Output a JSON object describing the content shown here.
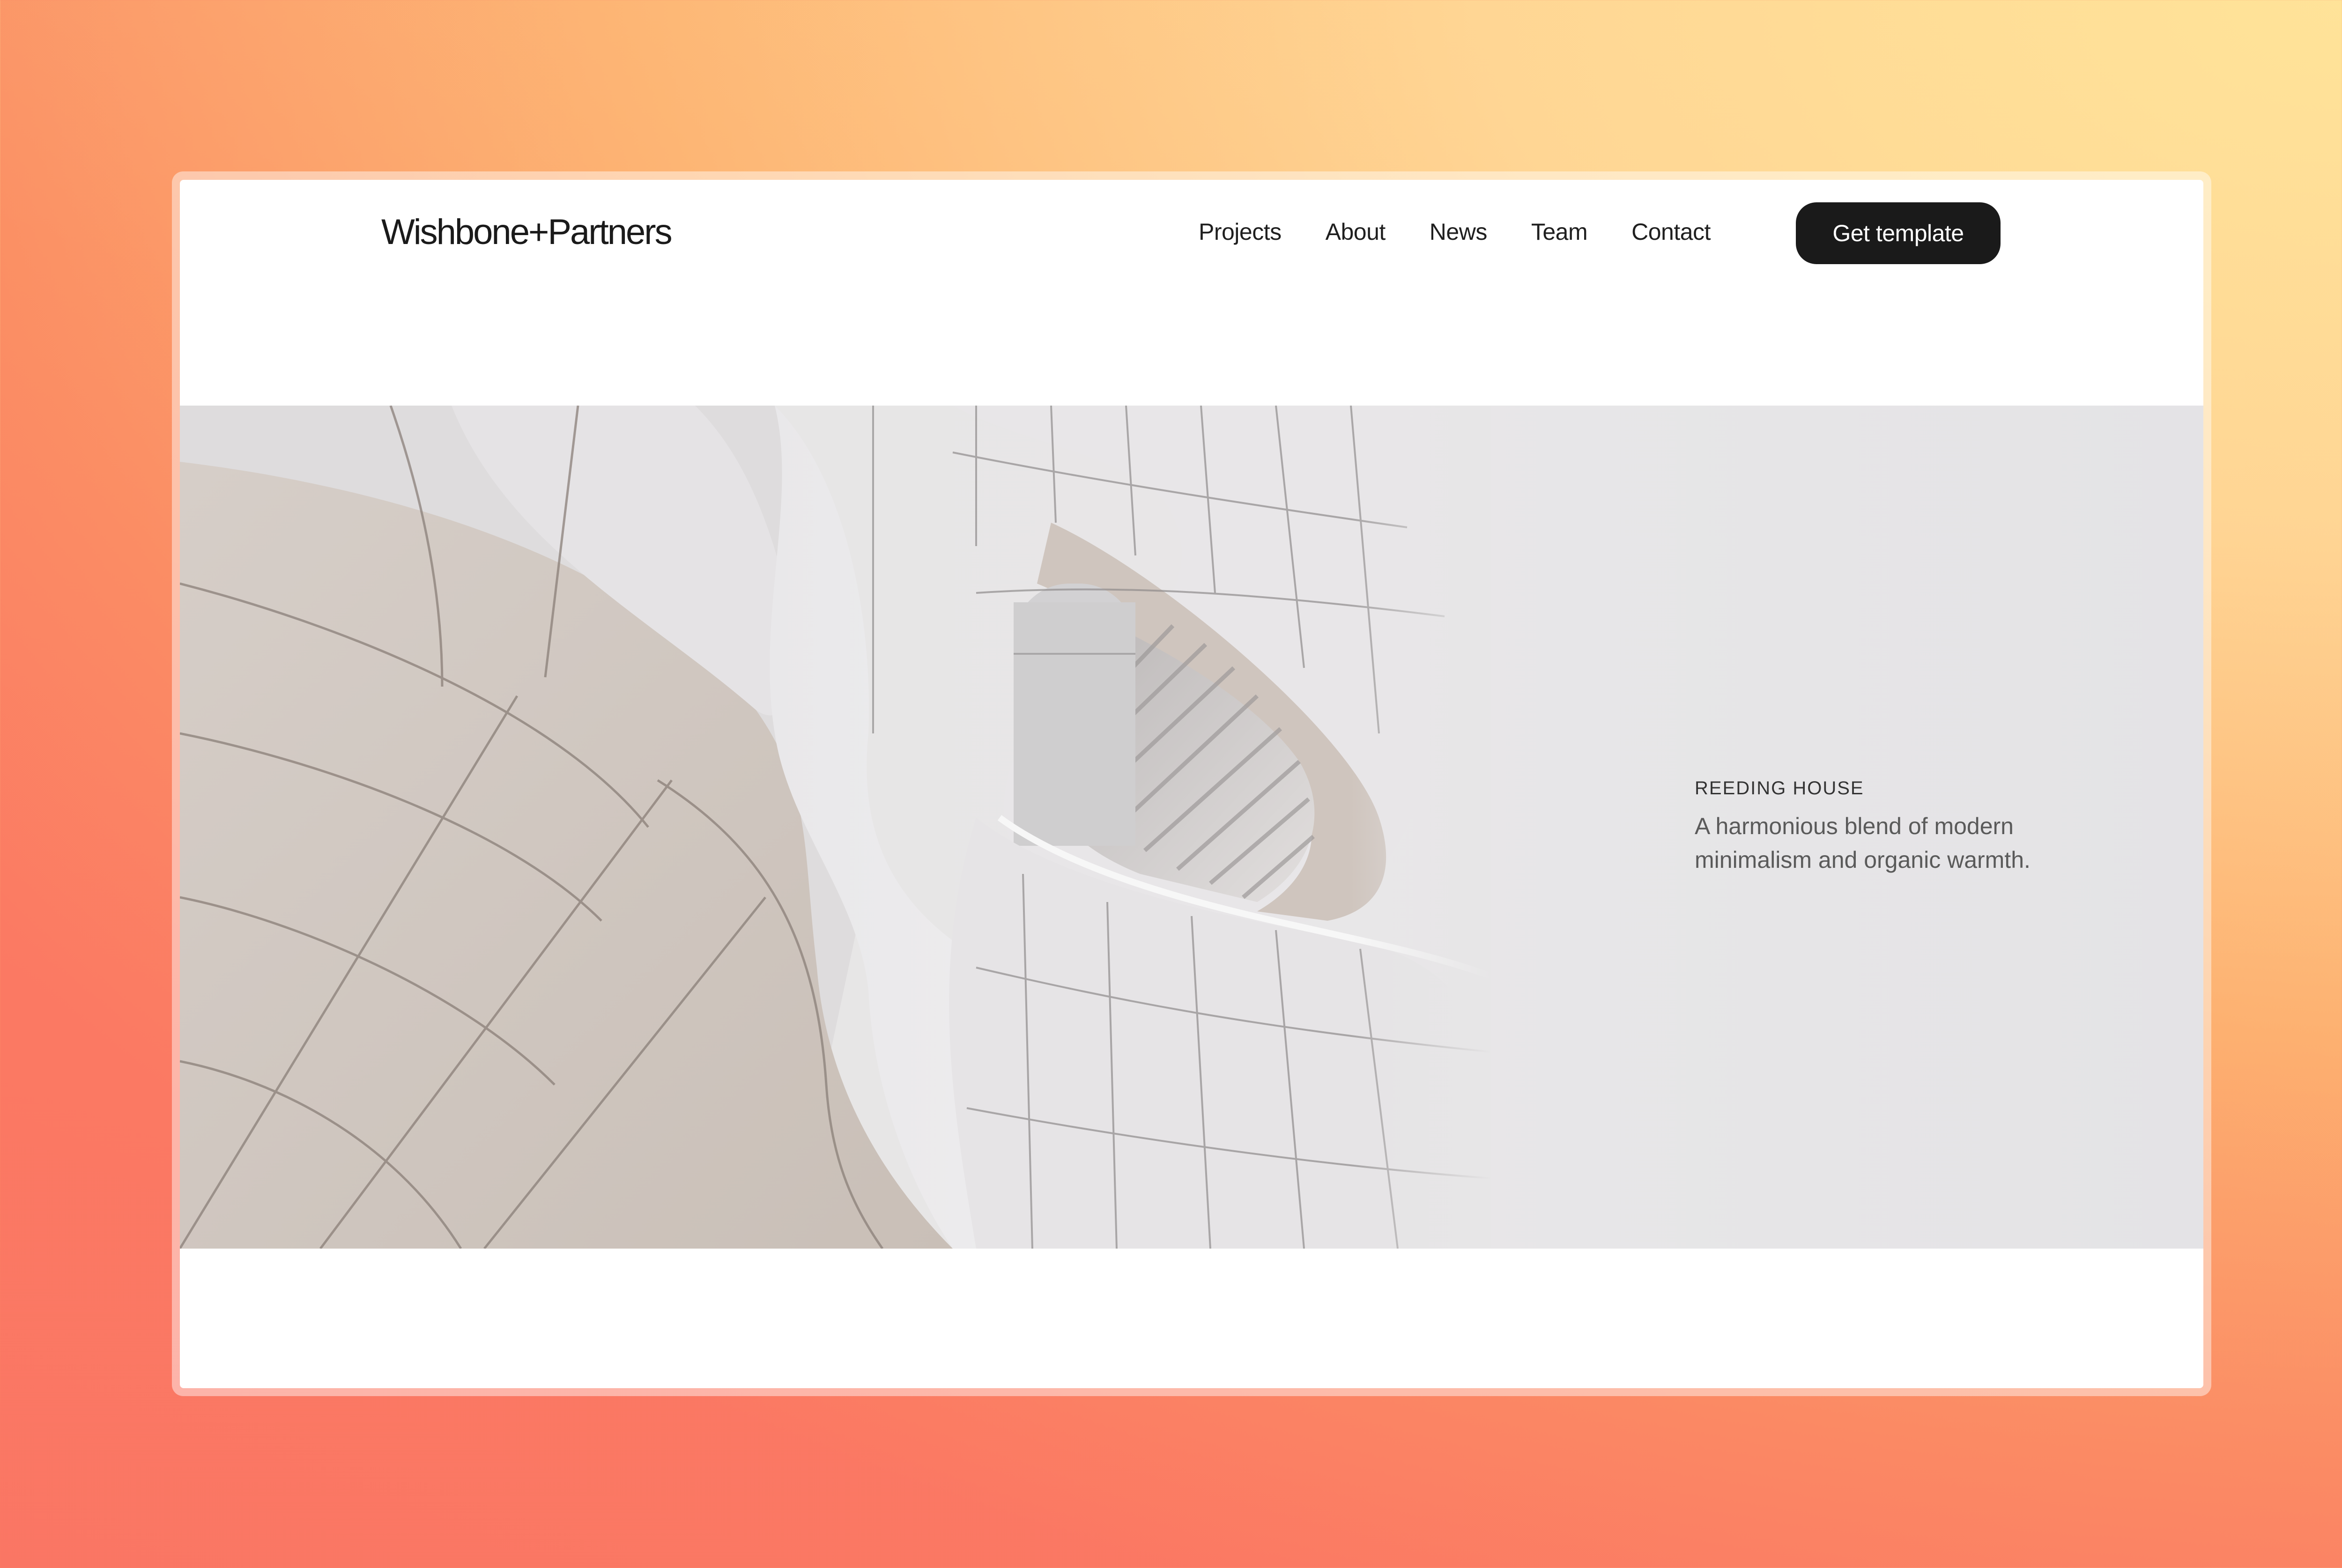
{
  "header": {
    "logo": "Wishbone+Partners",
    "nav": [
      "Projects",
      "About",
      "News",
      "Team",
      "Contact"
    ],
    "cta_label": "Get template"
  },
  "hero": {
    "image_icon": "architecture-photo",
    "project_title": "REEDING HOUSE",
    "project_description": "A harmonious blend of modern minimalism and organic warmth."
  },
  "colors": {
    "background_gradient_top": "#ffe49a",
    "background_gradient_bottom": "#fb7d63",
    "cta_background": "#1a1a1a",
    "hero_background": "#e7e6e7"
  }
}
